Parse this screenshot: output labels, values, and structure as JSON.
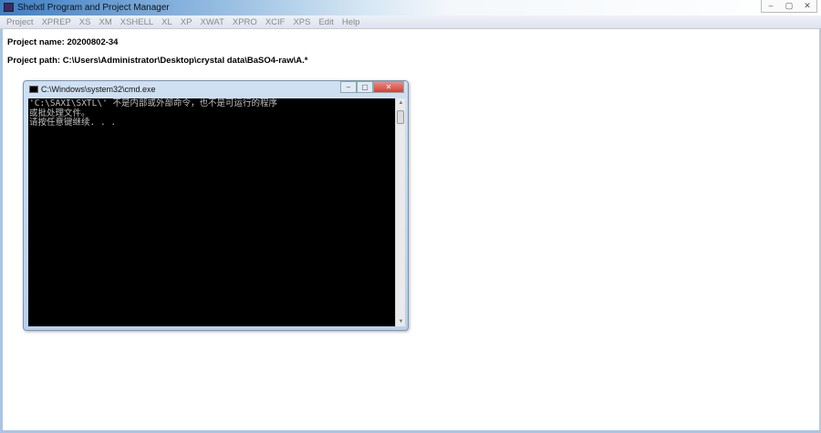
{
  "window": {
    "title": "Shelxtl Program and Project Manager",
    "controls": [
      "–",
      "▢",
      "✕"
    ]
  },
  "menu": [
    "Project",
    "XPREP",
    "XS",
    "XM",
    "XSHELL",
    "XL",
    "XP",
    "XWAT",
    "XPRO",
    "XCIF",
    "XPS",
    "Edit",
    "Help"
  ],
  "project": {
    "name_line": "Project name: 20200802-34",
    "path_line": "Project path: C:\\Users\\Administrator\\Desktop\\crystal data\\BaSO4-raw\\A.*"
  },
  "cmd": {
    "title": "C:\\Windows\\system32\\cmd.exe",
    "controls": [
      "–",
      "▢",
      "✕"
    ],
    "lines": [
      "'C:\\SAXI\\SXTL\\' 不是内部或外部命令，也不是可运行的程序",
      "或批处理文件。",
      "请按任意键继续. . ."
    ]
  }
}
